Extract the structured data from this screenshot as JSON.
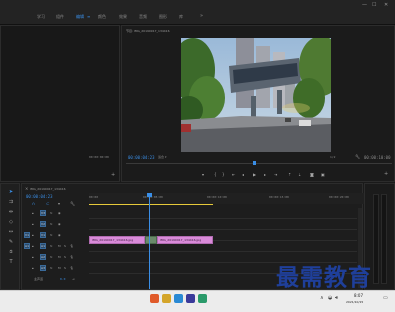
{
  "menu": {
    "items": [
      "学习",
      "组件",
      "编辑",
      "颜色",
      "效果",
      "音频",
      "图形",
      "库"
    ],
    "active_index": 2
  },
  "program_monitor": {
    "title": "节目: IMG_20190917_134416",
    "timecode_current": "00:00:04:23",
    "timecode_total": "00:00:10:00",
    "fit": "1/2"
  },
  "source_monitor": {
    "timecode_left": "00:00:00:00",
    "timecode_right": "00:00:00:00"
  },
  "timeline": {
    "title": "IMG_20190917_134416",
    "timecode": "00:00:04:23",
    "ruler_ticks": [
      "00:00",
      "00:00:05:00",
      "00:00:10:00",
      "00:00:15:00",
      "00:00:20:00"
    ],
    "video_tracks": [
      "V3",
      "V2",
      "V1"
    ],
    "audio_tracks": [
      "A1",
      "A2",
      "A3"
    ],
    "master": "主声道",
    "master_value": "0.0",
    "clips": [
      {
        "label": "IMG_20190917_134416.jpg"
      },
      {
        "label": "IMG_20190917_134416.jpg"
      }
    ]
  },
  "taskbar": {
    "time": "8:07",
    "date": "2021/10/15"
  },
  "watermark": "最需教育",
  "colors": {
    "accent": "#3a8ee6",
    "clip": "#d98bd9",
    "watermark": "#1f3f9a"
  }
}
